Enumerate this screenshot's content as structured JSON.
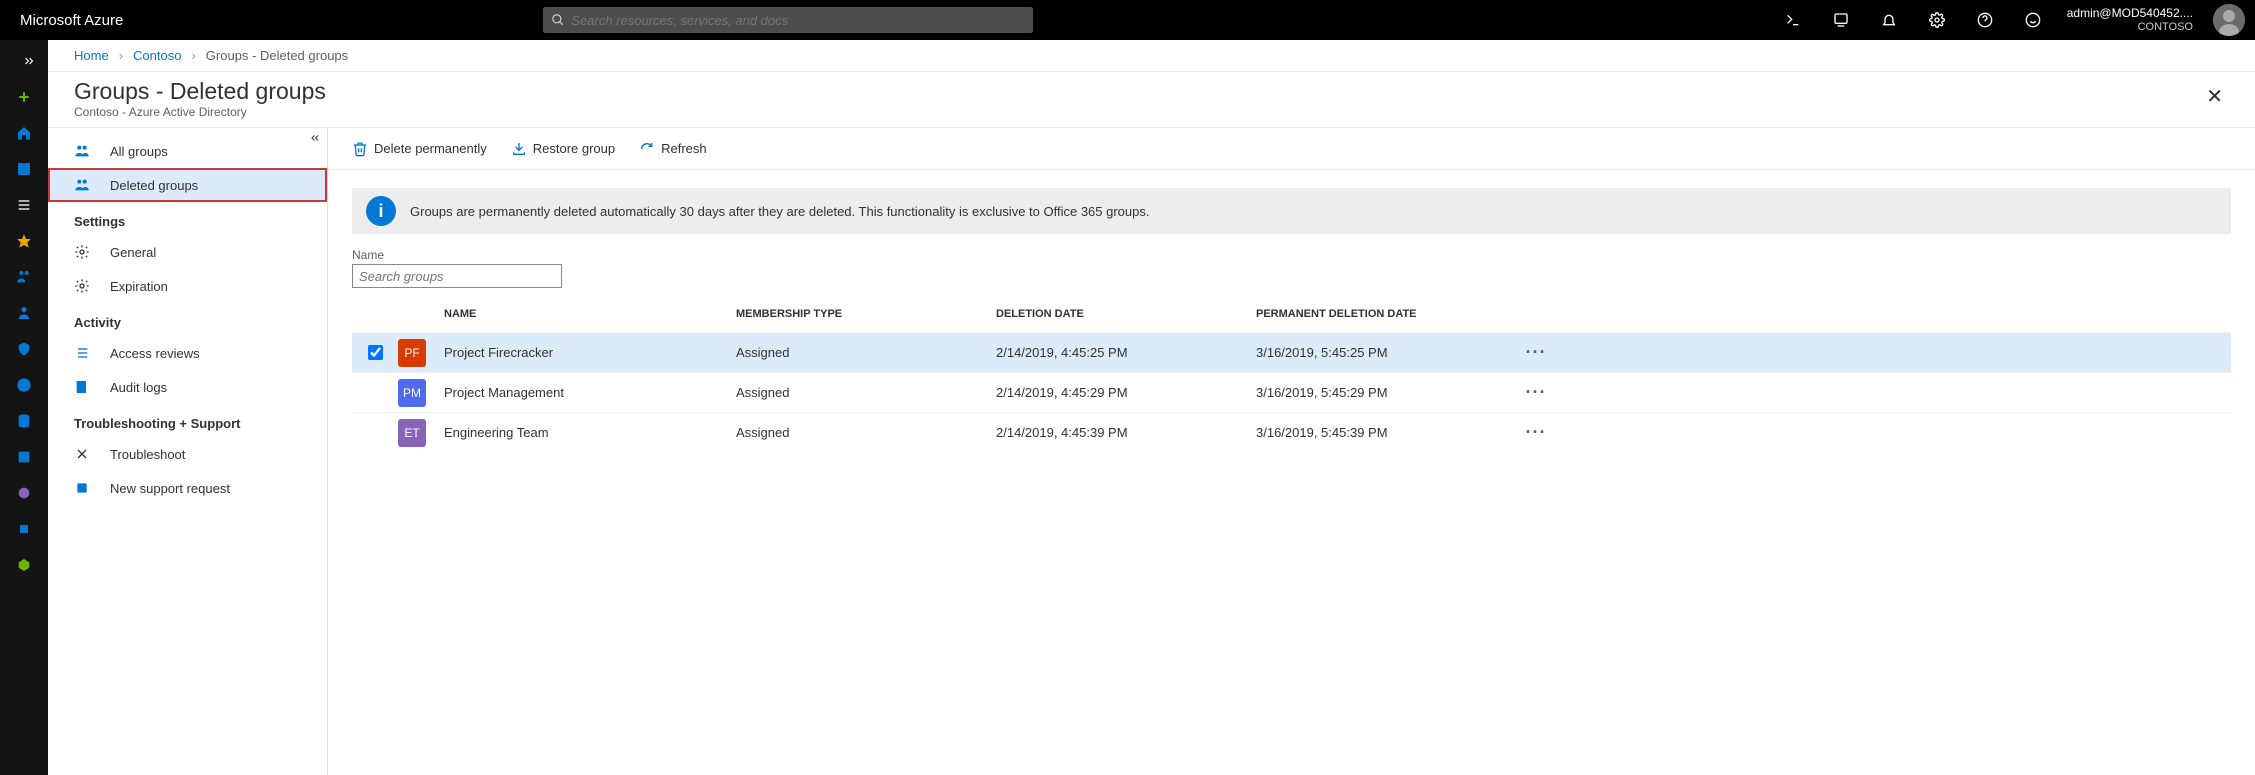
{
  "brand": "Microsoft Azure",
  "search": {
    "placeholder": "Search resources, services, and docs"
  },
  "account": {
    "user": "admin@MOD540452....",
    "org": "CONTOSO"
  },
  "breadcrumbs": {
    "home": "Home",
    "tenant": "Contoso",
    "current": "Groups - Deleted groups"
  },
  "page": {
    "title": "Groups - Deleted groups",
    "subtitle": "Contoso - Azure Active Directory"
  },
  "leftnav": {
    "items": {
      "all_groups": "All groups",
      "deleted_groups": "Deleted groups"
    },
    "settings_label": "Settings",
    "settings": {
      "general": "General",
      "expiration": "Expiration"
    },
    "activity_label": "Activity",
    "activity": {
      "access_reviews": "Access reviews",
      "audit_logs": "Audit logs"
    },
    "troubleshoot_label": "Troubleshooting + Support",
    "troubleshoot": {
      "troubleshoot": "Troubleshoot",
      "new_request": "New support request"
    }
  },
  "toolbar": {
    "delete_label": "Delete permanently",
    "restore_label": "Restore group",
    "refresh_label": "Refresh"
  },
  "info_message": "Groups are permanently deleted automatically 30 days after they are deleted. This functionality is exclusive to Office 365 groups.",
  "filter": {
    "label": "Name",
    "placeholder": "Search groups"
  },
  "columns": {
    "name": "NAME",
    "membership": "MEMBERSHIP TYPE",
    "deletion": "DELETION DATE",
    "permanent": "PERMANENT DELETION DATE"
  },
  "rows": [
    {
      "initials": "PF",
      "color": "#d83b01",
      "name": "Project Firecracker",
      "membership": "Assigned",
      "deletion": "2/14/2019, 4:45:25 PM",
      "permanent": "3/16/2019, 5:45:25 PM",
      "selected": true
    },
    {
      "initials": "PM",
      "color": "#4f6bed",
      "name": "Project Management",
      "membership": "Assigned",
      "deletion": "2/14/2019, 4:45:29 PM",
      "permanent": "3/16/2019, 5:45:29 PM",
      "selected": false
    },
    {
      "initials": "ET",
      "color": "#8764b8",
      "name": "Engineering Team",
      "membership": "Assigned",
      "deletion": "2/14/2019, 4:45:39 PM",
      "permanent": "3/16/2019, 5:45:39 PM",
      "selected": false
    }
  ]
}
